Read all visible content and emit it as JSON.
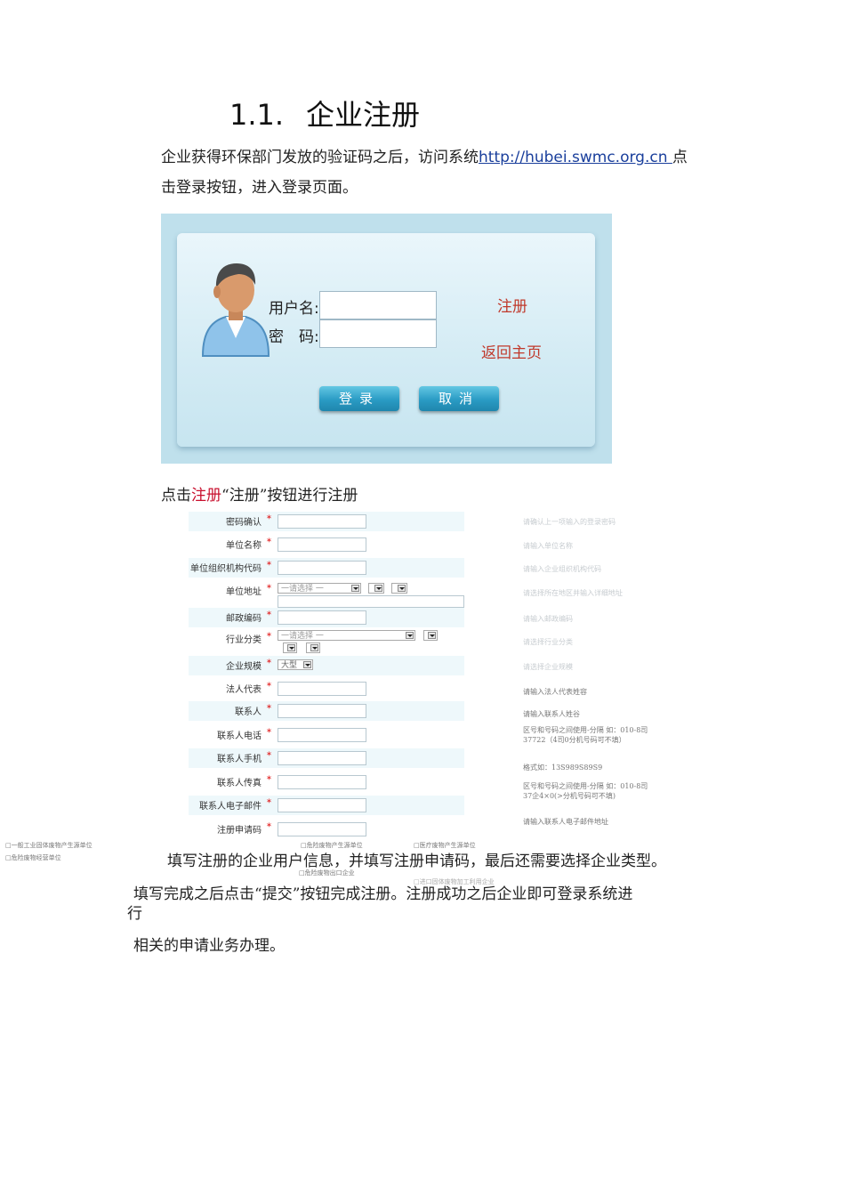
{
  "heading": {
    "number": "1.1.",
    "title": "企业注册"
  },
  "intro": {
    "before_link": "企业获得环保部门发放的验证码之后，访问系统",
    "link": "http://hubei.swmc.org.cn ",
    "after_link": "点",
    "line2": "击登录按钮，进入登录页面。"
  },
  "login": {
    "username_label": "用户名:",
    "password_label": "密　码:",
    "register_link": "注册",
    "home_link": "返回主页",
    "login_button": "登录",
    "cancel_button": "取消"
  },
  "caption": {
    "prefix": "点击",
    "red": "注册",
    "rest": "“注册”按钮进行注册"
  },
  "form": {
    "fields": [
      {
        "label": "密码确认",
        "hint": "请确认上一项输入的登录密码"
      },
      {
        "label": "单位名称",
        "hint": "请输入单位名称"
      },
      {
        "label": "单位组织机构代码",
        "hint": "请输入企业组织机构代码"
      },
      {
        "label": "单位地址",
        "hint": "请选择所在地区并输入详细地址"
      },
      {
        "label": "邮政编码",
        "hint": "请输入邮政编码"
      },
      {
        "label": "行业分类",
        "hint": "请选择行业分类"
      },
      {
        "label": "企业规模",
        "hint": "请选择企业规模"
      },
      {
        "label": "法人代表",
        "hint": "请输入法人代表姓容"
      },
      {
        "label": "联系人",
        "hint": "请输入联系人姓谷"
      },
      {
        "label": "联系人电话",
        "hint": "区号和号码之间使用-分隔 如：010-8司37722（4司0分机号码可不填）"
      },
      {
        "label": "联系人手机",
        "hint": "格式如：13S989S89S9"
      },
      {
        "label": "联系人传真",
        "hint": "区号和号码之间使用-分隔 如：010-8司37企4×0(>分机号码可不填)"
      },
      {
        "label": "联系人电子邮件",
        "hint": "请输入联系人电子邮件地址"
      },
      {
        "label": "注册申请码",
        "hint": ""
      }
    ],
    "select_placeholder": "一请选择 一",
    "scale_value": "大型",
    "required_mark": "*"
  },
  "checkboxes": {
    "c1": "□一般工业固体废物产生源单位",
    "c2": "□危险废物产生源单位",
    "c3": "□医疗废物产生源单位",
    "c4": "□危险废物经营单位",
    "c5": "□危险废物出口企业",
    "c6": "□进口固体废物加工利用企业"
  },
  "body": {
    "p1": "填写注册的企业用户信息，并填写注册申请码，最后还需要选择企业类型。",
    "p2a": "填写完成之后点击“提交”按钮完成注册。注册成功之后企业即可登录系统进",
    "p2b": "行",
    "p3": "相关的申请业务办理。"
  }
}
